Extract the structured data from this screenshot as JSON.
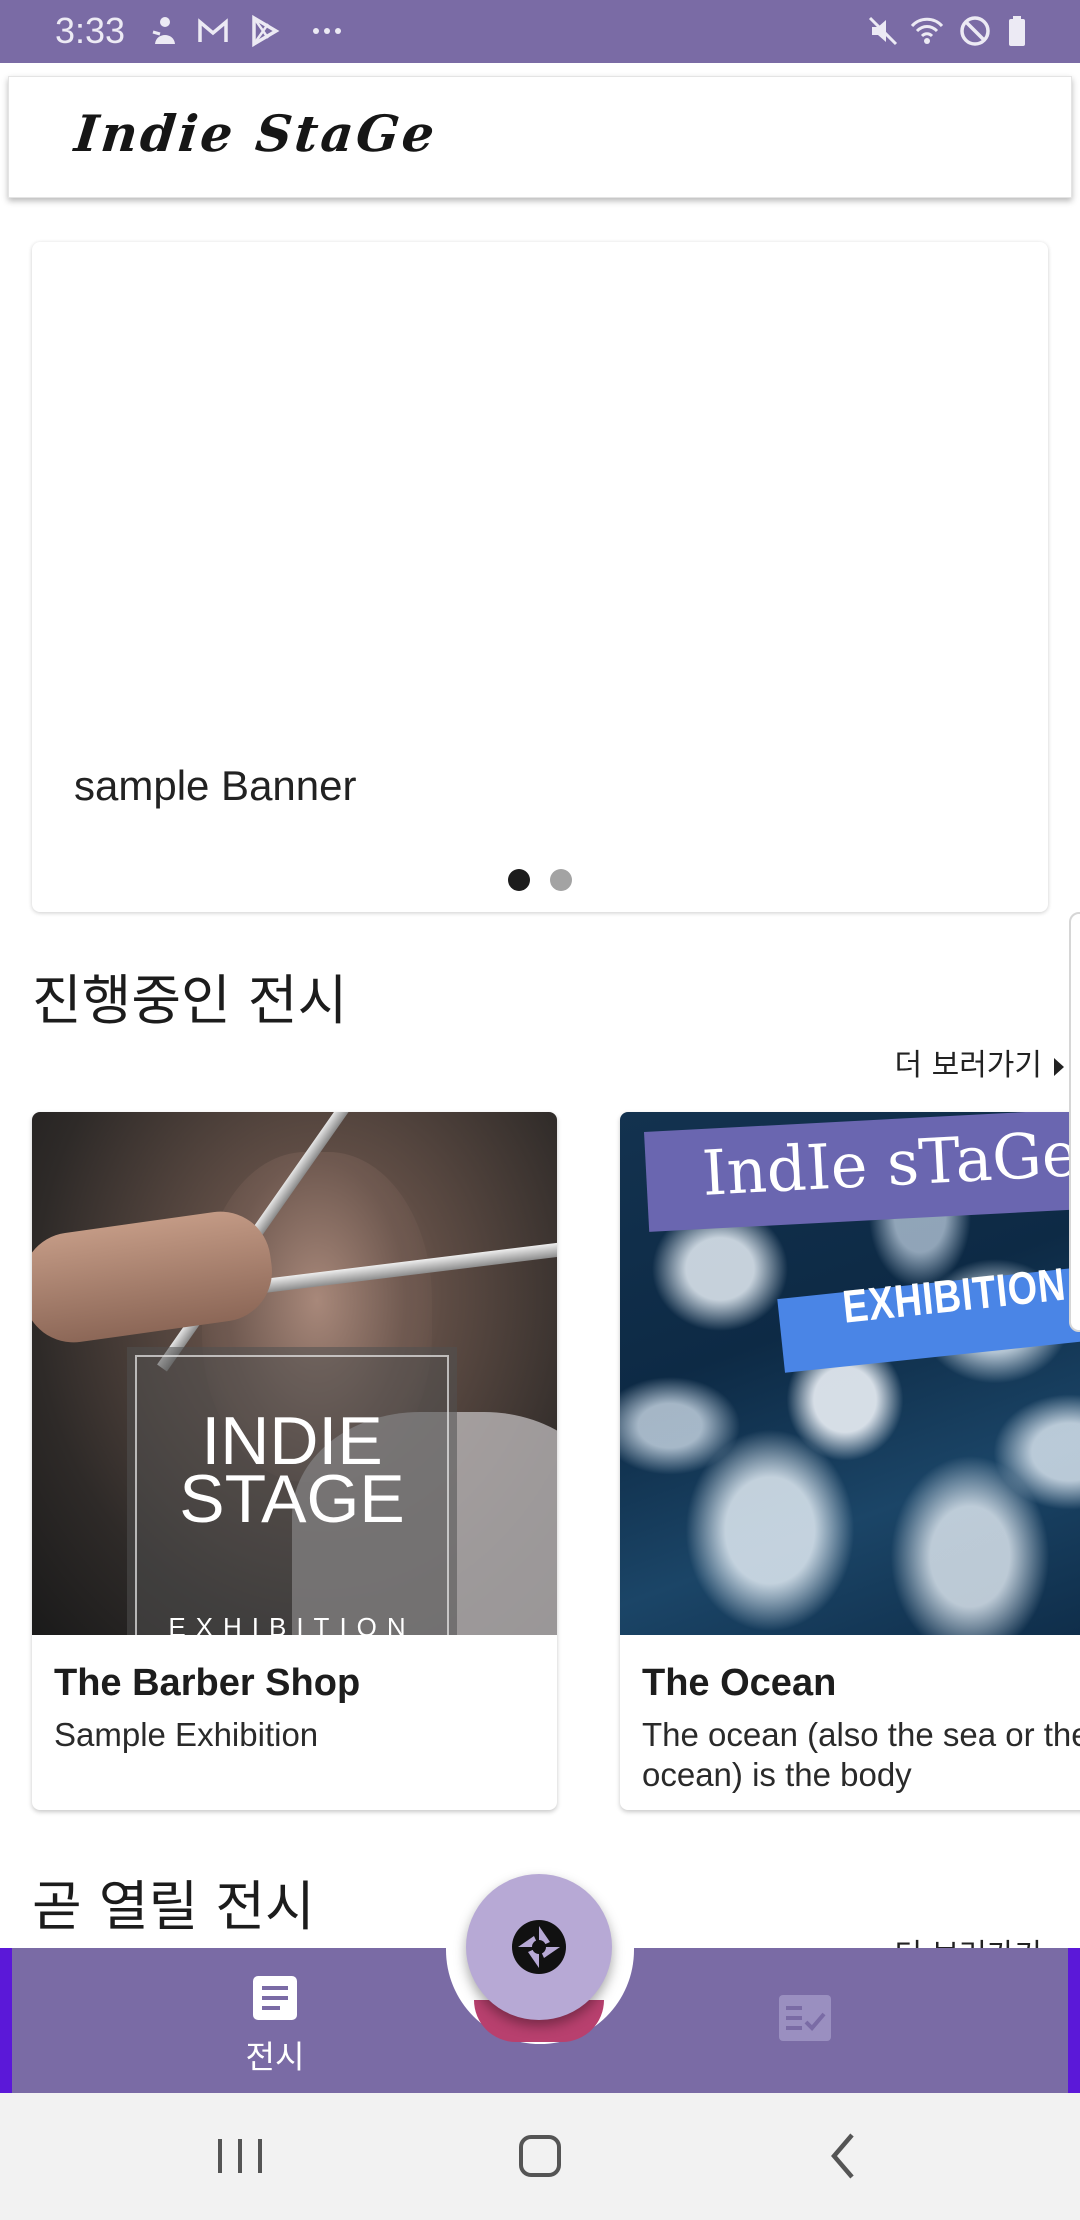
{
  "status_bar": {
    "time": "3:33",
    "left_icons": [
      "person-icon",
      "gmail-icon",
      "play-store-icon",
      "more-dots-icon"
    ],
    "right_icons": [
      "mute-icon",
      "wifi-icon",
      "do-not-disturb-icon",
      "battery-icon"
    ]
  },
  "app_bar": {
    "logo_text": "Indie StaGe"
  },
  "banner": {
    "title": "sample Banner",
    "page_indicator": {
      "count": 2,
      "active_index": 0
    }
  },
  "ongoing": {
    "title": "진행중인 전시",
    "more_label": "더 보러가기",
    "cards": [
      {
        "title": "The Barber Shop",
        "description": "Sample Exhibition",
        "image": {
          "overlay_title": "INDIE STAGE",
          "overlay_subtitle": "EXHIBITION"
        }
      },
      {
        "title": "The Ocean",
        "description": "The ocean (also the sea or the world ocean) is the body",
        "image": {
          "banner_text": "IndIe sTaGe",
          "sub_banner_text": "EXHIBITION"
        }
      }
    ]
  },
  "upcoming": {
    "title": "곧 열릴 전시",
    "more_label": "더 보러가기"
  },
  "bottom_nav": {
    "items": [
      {
        "label": "전시",
        "icon": "exhibition-list-icon"
      },
      {
        "label": "",
        "icon": "checklist-icon"
      }
    ],
    "fab_icon": "camera-shutter-icon"
  },
  "colors": {
    "primary": "#7a6ba5",
    "fab": "#b7a9d5",
    "accent_edge": "#5b18d8",
    "notch_accent": "#b8406e"
  },
  "system_nav": {
    "buttons": [
      "recents-icon",
      "home-icon",
      "back-icon"
    ]
  }
}
